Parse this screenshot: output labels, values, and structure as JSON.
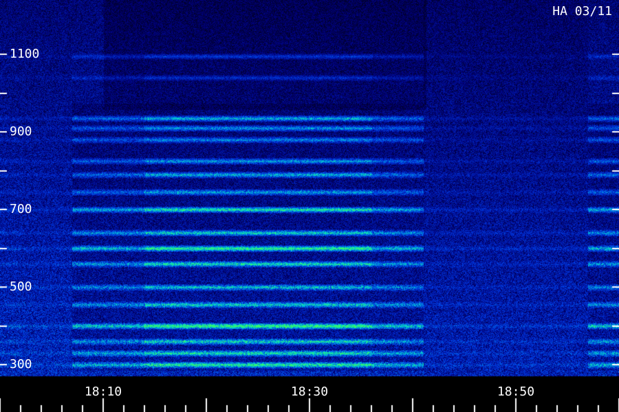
{
  "stamp": "HA 03/11",
  "colors": {
    "background": "#000000",
    "low": "#0000c8",
    "mid": "#00c8d8",
    "high": "#30ff60",
    "text": "#ffffff"
  },
  "chart_data": {
    "type": "heatmap",
    "title": "",
    "xlabel": "",
    "ylabel": "",
    "y_ticks": [
      "1100",
      "900",
      "700",
      "500",
      "300"
    ],
    "y_tick_values": [
      1100,
      900,
      700,
      500,
      300
    ],
    "y_minor_tick_values": [
      1000,
      800,
      600,
      400
    ],
    "ylim": [
      270,
      1240
    ],
    "x_ticks": [
      "18:10",
      "18:30",
      "18:50"
    ],
    "x_tick_values": [
      10,
      30,
      50
    ],
    "xlim": [
      "18:00",
      "19:00"
    ],
    "x_range_minutes": [
      0,
      60
    ],
    "horizontal_bands": [
      {
        "y": 1095,
        "intensity": 0.35
      },
      {
        "y": 1040,
        "intensity": 0.3
      },
      {
        "y": 935,
        "intensity": 0.65
      },
      {
        "y": 910,
        "intensity": 0.55
      },
      {
        "y": 880,
        "intensity": 0.5
      },
      {
        "y": 825,
        "intensity": 0.55
      },
      {
        "y": 790,
        "intensity": 0.6
      },
      {
        "y": 745,
        "intensity": 0.55
      },
      {
        "y": 700,
        "intensity": 0.85
      },
      {
        "y": 640,
        "intensity": 0.7
      },
      {
        "y": 600,
        "intensity": 0.95
      },
      {
        "y": 560,
        "intensity": 0.75
      },
      {
        "y": 500,
        "intensity": 0.6
      },
      {
        "y": 455,
        "intensity": 0.65
      },
      {
        "y": 400,
        "intensity": 1.0
      },
      {
        "y": 360,
        "intensity": 0.65
      },
      {
        "y": 330,
        "intensity": 0.7
      },
      {
        "y": 300,
        "intensity": 0.8
      }
    ],
    "active_intervals_minutes": [
      [
        7,
        41
      ],
      [
        57,
        60
      ]
    ],
    "strong_interval_minutes": [
      14,
      36
    ]
  }
}
